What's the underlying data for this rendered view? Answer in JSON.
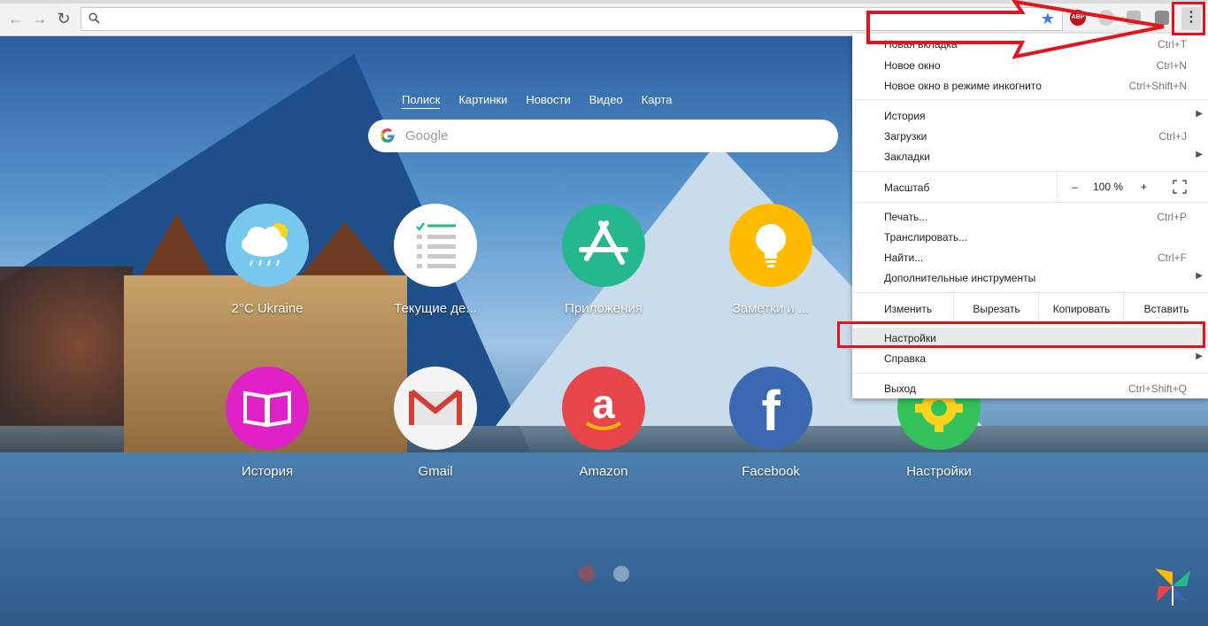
{
  "omnibox": {
    "value": ""
  },
  "extensions": {
    "abp_label": "ABP"
  },
  "search": {
    "tabs": [
      "Полиск",
      "Картинки",
      "Новости",
      "Видео",
      "Карта"
    ],
    "placeholder": "Google"
  },
  "tiles": [
    {
      "label": "2°C Ukraine",
      "icon": "weather-icon",
      "color": "#77c8ee"
    },
    {
      "label": "Текущие де...",
      "icon": "checklist-icon",
      "color": "#ffffff"
    },
    {
      "label": "Приложения",
      "icon": "app-store-icon",
      "color": "#25b88f"
    },
    {
      "label": "Заметки и ...",
      "icon": "lightbulb-icon",
      "color": "#ffbb00"
    },
    {
      "label": "История",
      "icon": "book-icon",
      "color": "#e021c8"
    },
    {
      "label": "Gmail",
      "icon": "gmail-icon",
      "color": "#f5f5f5"
    },
    {
      "label": "Amazon",
      "icon": "amazon-icon",
      "color": "#e8454a"
    },
    {
      "label": "Facebook",
      "icon": "facebook-icon",
      "color": "#3b68b3"
    },
    {
      "label": "Настройки",
      "icon": "gear-icon",
      "color": "#33c25a"
    }
  ],
  "menu": {
    "new_tab": {
      "label": "Новая вкладка",
      "shortcut": "Ctrl+T"
    },
    "new_window": {
      "label": "Новое окно",
      "shortcut": "Ctrl+N"
    },
    "incognito": {
      "label": "Новое окно в режиме инкогнито",
      "shortcut": "Ctrl+Shift+N"
    },
    "history": {
      "label": "История"
    },
    "downloads": {
      "label": "Загрузки",
      "shortcut": "Ctrl+J"
    },
    "bookmarks": {
      "label": "Закладки"
    },
    "zoom": {
      "label": "Масштаб",
      "minus": "–",
      "value": "100 %",
      "plus": "+"
    },
    "print": {
      "label": "Печать...",
      "shortcut": "Ctrl+P"
    },
    "cast": {
      "label": "Транслировать..."
    },
    "find": {
      "label": "Найти...",
      "shortcut": "Ctrl+F"
    },
    "more_tools": {
      "label": "Дополнительные инструменты"
    },
    "edit": {
      "label": "Изменить",
      "cut": "Вырезать",
      "copy": "Копировать",
      "paste": "Вставить"
    },
    "settings": {
      "label": "Настройки"
    },
    "help": {
      "label": "Справка"
    },
    "exit": {
      "label": "Выход",
      "shortcut": "Ctrl+Shift+Q"
    }
  },
  "colors": {
    "annotation": "#e3141b",
    "star": "#3d7de6"
  }
}
